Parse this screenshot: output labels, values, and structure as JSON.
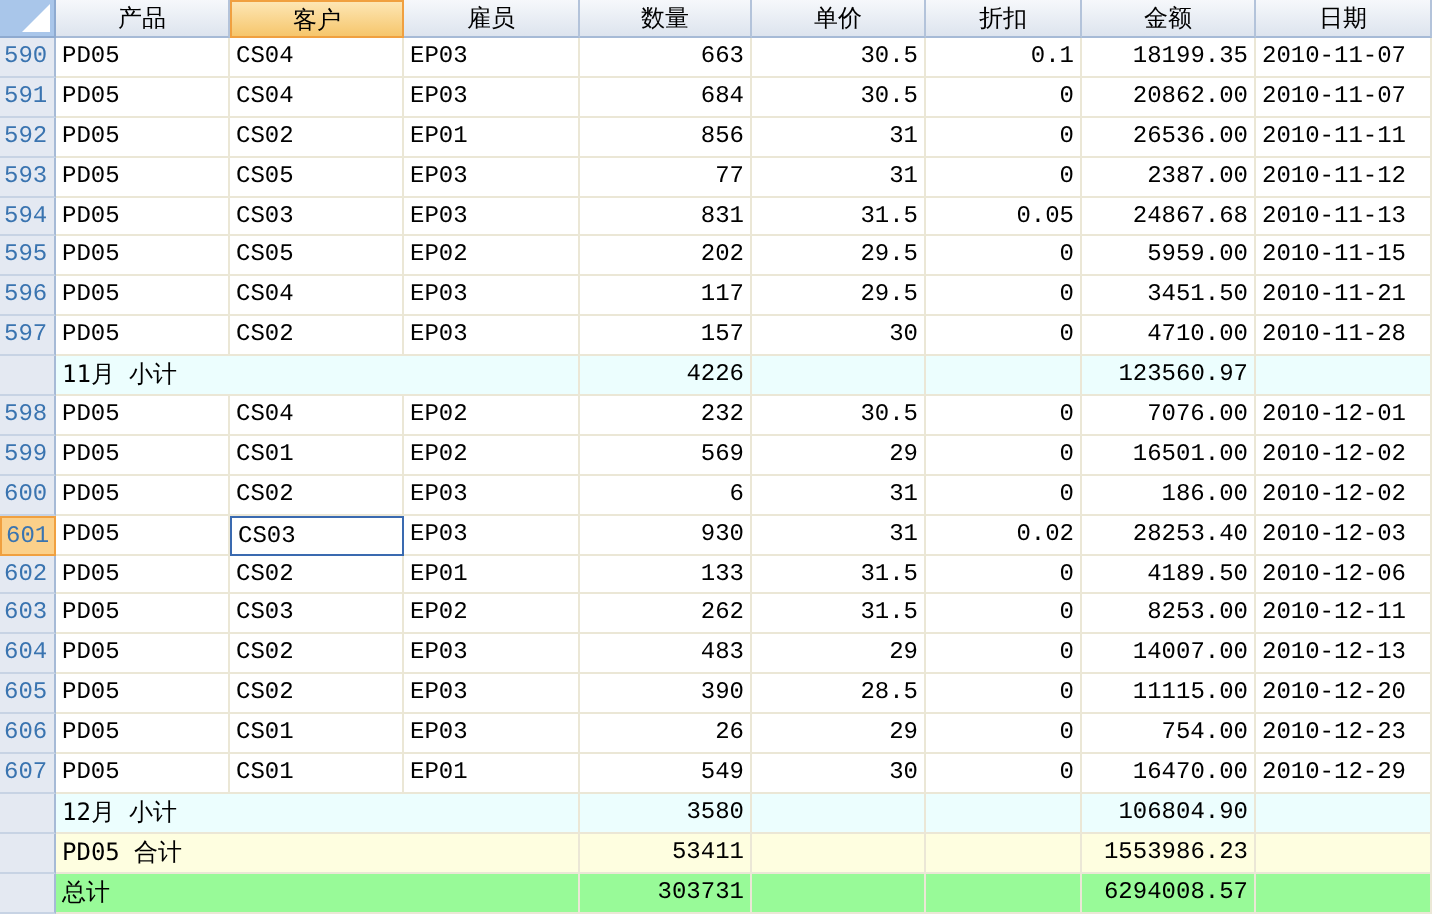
{
  "table": {
    "columns": [
      {
        "label": "产品",
        "selected": false
      },
      {
        "label": "客户",
        "selected": true
      },
      {
        "label": "雇员",
        "selected": false
      },
      {
        "label": "数量",
        "selected": false
      },
      {
        "label": "单价",
        "selected": false
      },
      {
        "label": "折扣",
        "selected": false
      },
      {
        "label": "金额",
        "selected": false
      },
      {
        "label": "日期",
        "selected": false
      }
    ],
    "rows": [
      {
        "kind": "data",
        "row_number": "590",
        "selected": false,
        "cells": [
          "PD05",
          "CS04",
          "EP03",
          "663",
          "30.5",
          "0.1",
          "18199.35",
          "2010-11-07"
        ]
      },
      {
        "kind": "data",
        "row_number": "591",
        "selected": false,
        "cells": [
          "PD05",
          "CS04",
          "EP03",
          "684",
          "30.5",
          "0",
          "20862.00",
          "2010-11-07"
        ]
      },
      {
        "kind": "data",
        "row_number": "592",
        "selected": false,
        "cells": [
          "PD05",
          "CS02",
          "EP01",
          "856",
          "31",
          "0",
          "26536.00",
          "2010-11-11"
        ]
      },
      {
        "kind": "data",
        "row_number": "593",
        "selected": false,
        "cells": [
          "PD05",
          "CS05",
          "EP03",
          "77",
          "31",
          "0",
          "2387.00",
          "2010-11-12"
        ]
      },
      {
        "kind": "data",
        "row_number": "594",
        "selected": false,
        "cells": [
          "PD05",
          "CS03",
          "EP03",
          "831",
          "31.5",
          "0.05",
          "24867.68",
          "2010-11-13"
        ]
      },
      {
        "kind": "data",
        "row_number": "595",
        "selected": false,
        "cells": [
          "PD05",
          "CS05",
          "EP02",
          "202",
          "29.5",
          "0",
          "5959.00",
          "2010-11-15"
        ]
      },
      {
        "kind": "data",
        "row_number": "596",
        "selected": false,
        "cells": [
          "PD05",
          "CS04",
          "EP03",
          "117",
          "29.5",
          "0",
          "3451.50",
          "2010-11-21"
        ]
      },
      {
        "kind": "data",
        "row_number": "597",
        "selected": false,
        "cells": [
          "PD05",
          "CS02",
          "EP03",
          "157",
          "30",
          "0",
          "4710.00",
          "2010-11-28"
        ]
      },
      {
        "kind": "subtotal",
        "label": "11月 小计",
        "quantity": "4226",
        "amount": "123560.97"
      },
      {
        "kind": "data",
        "row_number": "598",
        "selected": false,
        "cells": [
          "PD05",
          "CS04",
          "EP02",
          "232",
          "30.5",
          "0",
          "7076.00",
          "2010-12-01"
        ]
      },
      {
        "kind": "data",
        "row_number": "599",
        "selected": false,
        "cells": [
          "PD05",
          "CS01",
          "EP02",
          "569",
          "29",
          "0",
          "16501.00",
          "2010-12-02"
        ]
      },
      {
        "kind": "data",
        "row_number": "600",
        "selected": false,
        "cells": [
          "PD05",
          "CS02",
          "EP03",
          "6",
          "31",
          "0",
          "186.00",
          "2010-12-02"
        ]
      },
      {
        "kind": "data",
        "row_number": "601",
        "selected": true,
        "cells": [
          "PD05",
          "CS03",
          "EP03",
          "930",
          "31",
          "0.02",
          "28253.40",
          "2010-12-03"
        ]
      },
      {
        "kind": "data",
        "row_number": "602",
        "selected": false,
        "cells": [
          "PD05",
          "CS02",
          "EP01",
          "133",
          "31.5",
          "0",
          "4189.50",
          "2010-12-06"
        ]
      },
      {
        "kind": "data",
        "row_number": "603",
        "selected": false,
        "cells": [
          "PD05",
          "CS03",
          "EP02",
          "262",
          "31.5",
          "0",
          "8253.00",
          "2010-12-11"
        ]
      },
      {
        "kind": "data",
        "row_number": "604",
        "selected": false,
        "cells": [
          "PD05",
          "CS02",
          "EP03",
          "483",
          "29",
          "0",
          "14007.00",
          "2010-12-13"
        ]
      },
      {
        "kind": "data",
        "row_number": "605",
        "selected": false,
        "cells": [
          "PD05",
          "CS02",
          "EP03",
          "390",
          "28.5",
          "0",
          "11115.00",
          "2010-12-20"
        ]
      },
      {
        "kind": "data",
        "row_number": "606",
        "selected": false,
        "cells": [
          "PD05",
          "CS01",
          "EP03",
          "26",
          "29",
          "0",
          "754.00",
          "2010-12-23"
        ]
      },
      {
        "kind": "data",
        "row_number": "607",
        "selected": false,
        "cells": [
          "PD05",
          "CS01",
          "EP01",
          "549",
          "30",
          "0",
          "16470.00",
          "2010-12-29"
        ]
      },
      {
        "kind": "subtotal",
        "label": "12月 小计",
        "quantity": "3580",
        "amount": "106804.90"
      },
      {
        "kind": "group_total",
        "label": "PD05 合计",
        "quantity": "53411",
        "amount": "1553986.23"
      },
      {
        "kind": "grand_total",
        "label": "总计",
        "quantity": "303731",
        "amount": "6294008.57"
      }
    ]
  }
}
